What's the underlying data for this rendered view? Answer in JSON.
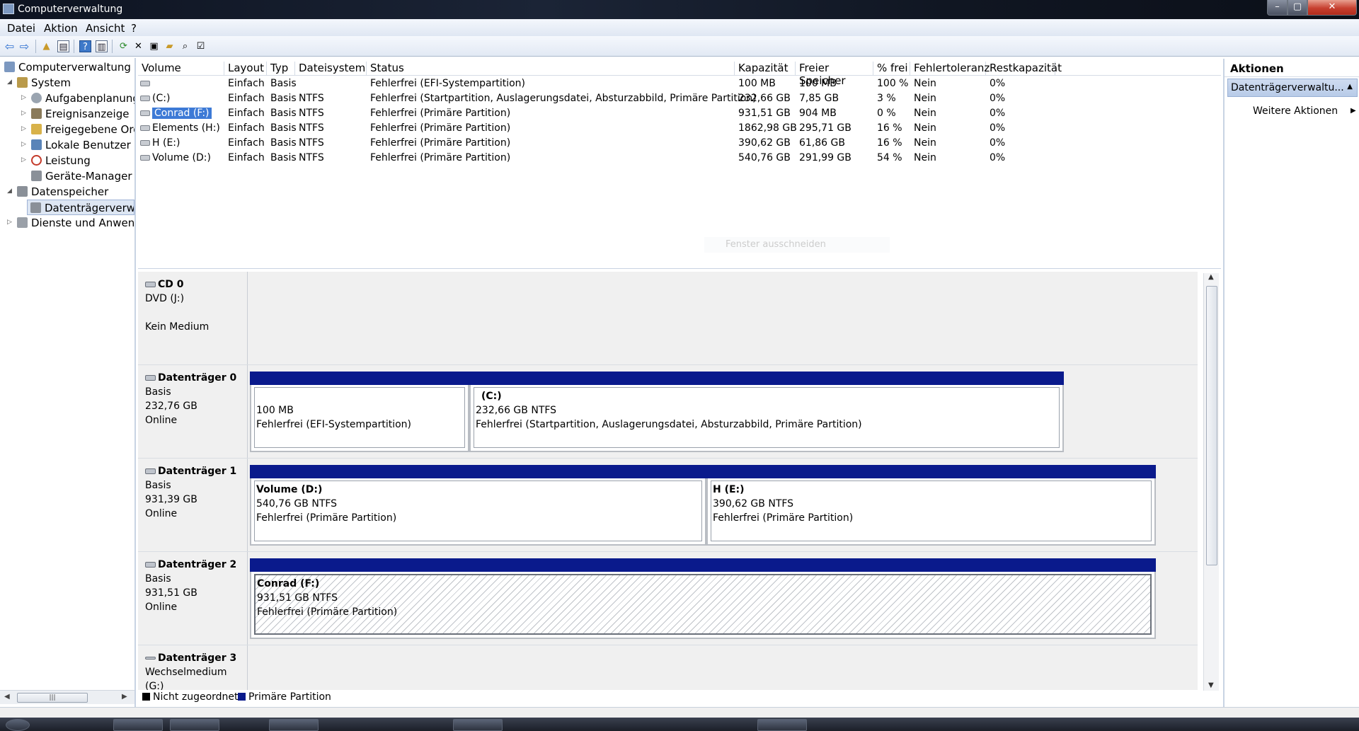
{
  "window": {
    "title": "Computerverwaltung"
  },
  "menu": [
    "Datei",
    "Aktion",
    "Ansicht",
    "?"
  ],
  "tree": [
    {
      "label": "Computerverwaltung (Lc",
      "icon": "computer-icon",
      "level": 0,
      "arrow": ""
    },
    {
      "label": "System",
      "icon": "tools-icon",
      "level": 1,
      "arrow": "◢"
    },
    {
      "label": "Aufgabenplanung",
      "icon": "clock-icon",
      "level": 2,
      "arrow": "▷"
    },
    {
      "label": "Ereignisanzeige",
      "icon": "event-icon",
      "level": 2,
      "arrow": "▷"
    },
    {
      "label": "Freigegebene Ordn",
      "icon": "shared-folder-icon",
      "level": 2,
      "arrow": "▷"
    },
    {
      "label": "Lokale Benutzer un",
      "icon": "users-icon",
      "level": 2,
      "arrow": "▷"
    },
    {
      "label": "Leistung",
      "icon": "performance-icon",
      "level": 2,
      "arrow": "▷"
    },
    {
      "label": "Geräte-Manager",
      "icon": "device-manager-icon",
      "level": 2,
      "arrow": ""
    },
    {
      "label": "Datenspeicher",
      "icon": "storage-icon",
      "level": 1,
      "arrow": "◢"
    },
    {
      "label": "Datenträgerverwal",
      "icon": "disk-management-icon",
      "level": 2,
      "arrow": "",
      "selected": true
    },
    {
      "label": "Dienste und Anwendu",
      "icon": "services-icon",
      "level": 1,
      "arrow": "▷"
    }
  ],
  "volume_table": {
    "columns": [
      "Volume",
      "Layout",
      "Typ",
      "Dateisystem",
      "Status",
      "Kapazität",
      "Freier Speicher",
      "% frei",
      "Fehlertoleranz",
      "Restkapazität"
    ],
    "rows": [
      [
        "",
        "Einfach",
        "Basis",
        "",
        "Fehlerfrei (EFI-Systempartition)",
        "100 MB",
        "100 MB",
        "100 %",
        "Nein",
        "0%"
      ],
      [
        "(C:)",
        "Einfach",
        "Basis",
        "NTFS",
        "Fehlerfrei (Startpartition, Auslagerungsdatei, Absturzabbild, Primäre Partition)",
        "232,66 GB",
        "7,85 GB",
        "3 %",
        "Nein",
        "0%"
      ],
      [
        "Conrad (F:)",
        "Einfach",
        "Basis",
        "NTFS",
        "Fehlerfrei (Primäre Partition)",
        "931,51 GB",
        "904 MB",
        "0 %",
        "Nein",
        "0%"
      ],
      [
        "Elements (H:)",
        "Einfach",
        "Basis",
        "NTFS",
        "Fehlerfrei (Primäre Partition)",
        "1862,98 GB",
        "295,71 GB",
        "16 %",
        "Nein",
        "0%"
      ],
      [
        "H (E:)",
        "Einfach",
        "Basis",
        "NTFS",
        "Fehlerfrei (Primäre Partition)",
        "390,62 GB",
        "61,86 GB",
        "16 %",
        "Nein",
        "0%"
      ],
      [
        "Volume (D:)",
        "Einfach",
        "Basis",
        "NTFS",
        "Fehlerfrei (Primäre Partition)",
        "540,76 GB",
        "291,99 GB",
        "54 %",
        "Nein",
        "0%"
      ]
    ],
    "selected_row": 2
  },
  "snip_overlay": "Fenster ausschneiden",
  "disks": [
    {
      "name": "CD 0",
      "lines": [
        "DVD (J:)",
        "",
        "Kein Medium"
      ],
      "partitions": []
    },
    {
      "name": "Datenträger 0",
      "lines": [
        "Basis",
        "232,76 GB",
        "Online"
      ],
      "partitions": [
        {
          "title": "",
          "size": "100 MB",
          "status": "Fehlerfrei (EFI-Systempartition)"
        },
        {
          "title": "(C:)",
          "size": "232,66 GB NTFS",
          "status": "Fehlerfrei (Startpartition, Auslagerungsdatei, Absturzabbild, Primäre Partition)"
        }
      ]
    },
    {
      "name": "Datenträger 1",
      "lines": [
        "Basis",
        "931,39 GB",
        "Online"
      ],
      "partitions": [
        {
          "title": "Volume  (D:)",
          "size": "540,76 GB NTFS",
          "status": "Fehlerfrei (Primäre Partition)"
        },
        {
          "title": "H  (E:)",
          "size": "390,62 GB NTFS",
          "status": "Fehlerfrei (Primäre Partition)"
        }
      ]
    },
    {
      "name": "Datenträger 2",
      "lines": [
        "Basis",
        "931,51 GB",
        "Online"
      ],
      "partitions": [
        {
          "title": "Conrad  (F:)",
          "size": "931,51 GB NTFS",
          "status": "Fehlerfrei (Primäre Partition)",
          "hatched": true
        }
      ]
    },
    {
      "name": "Datenträger 3",
      "lines": [
        "Wechselmedium (G:)"
      ],
      "partitions": []
    }
  ],
  "legend": [
    {
      "label": "Nicht zugeordnet",
      "color": "#000000"
    },
    {
      "label": "Primäre Partition",
      "color": "#0a1a8c"
    }
  ],
  "actions": {
    "header": "Aktionen",
    "section": "Datenträgerverwaltu...",
    "more": "Weitere Aktionen"
  }
}
